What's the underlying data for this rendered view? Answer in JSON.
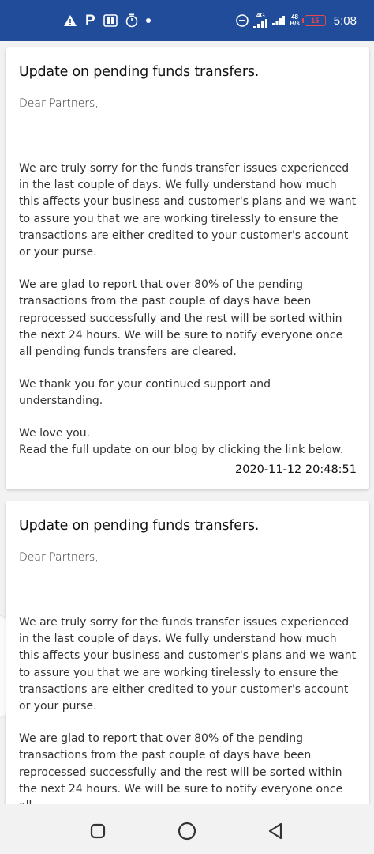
{
  "status_bar": {
    "network_type": "4G",
    "speed_value": "48",
    "speed_unit": "B/s",
    "battery": "15",
    "time": "5:08",
    "icons": [
      "warning-icon",
      "p-app-icon",
      "sim-icon",
      "timer-icon",
      "dot-icon",
      "do-not-disturb-icon",
      "signal-icon",
      "signal-icon",
      "battery-icon"
    ],
    "background_color": "#214c9a"
  },
  "posts": [
    {
      "title": "Update on pending funds transfers.",
      "salutation": "Dear Partners,",
      "paragraphs": [
        "We are truly sorry for the funds transfer issues experienced in the last couple of days. We fully understand how much this affects your business and customer's plans and we want to assure you that we are working tirelessly to ensure the transactions are either credited to your customer's account or your purse.",
        "We are glad to report that over 80% of the pending transactions from the past couple of days have been reprocessed successfully and the rest will be sorted within the next 24 hours.  We will be sure to notify everyone once all pending funds transfers are cleared.",
        "We thank you for your continued support and understanding."
      ],
      "closing_line_1": "We love you.",
      "closing_line_2": "Read the full update on our blog by clicking the link below.",
      "timestamp": "2020-11-12 20:48:51"
    },
    {
      "title": "Update on pending funds transfers.",
      "salutation": "Dear Partners,",
      "paragraphs": [
        "We are truly sorry for the funds transfer issues experienced in the last couple of days. We fully understand how much this affects your business and customer's plans and we want to assure you that we are working tirelessly to ensure the transactions are either credited to your customer's account or your purse.",
        "We are glad to report that over 80% of the pending transactions from the past couple of days have been reprocessed successfully and the rest will be sorted within the next 24 hours.  We will be sure to notify everyone once all"
      ]
    }
  ],
  "nav_bar": {
    "icons": [
      "recent-apps-icon",
      "home-icon",
      "back-icon"
    ]
  }
}
